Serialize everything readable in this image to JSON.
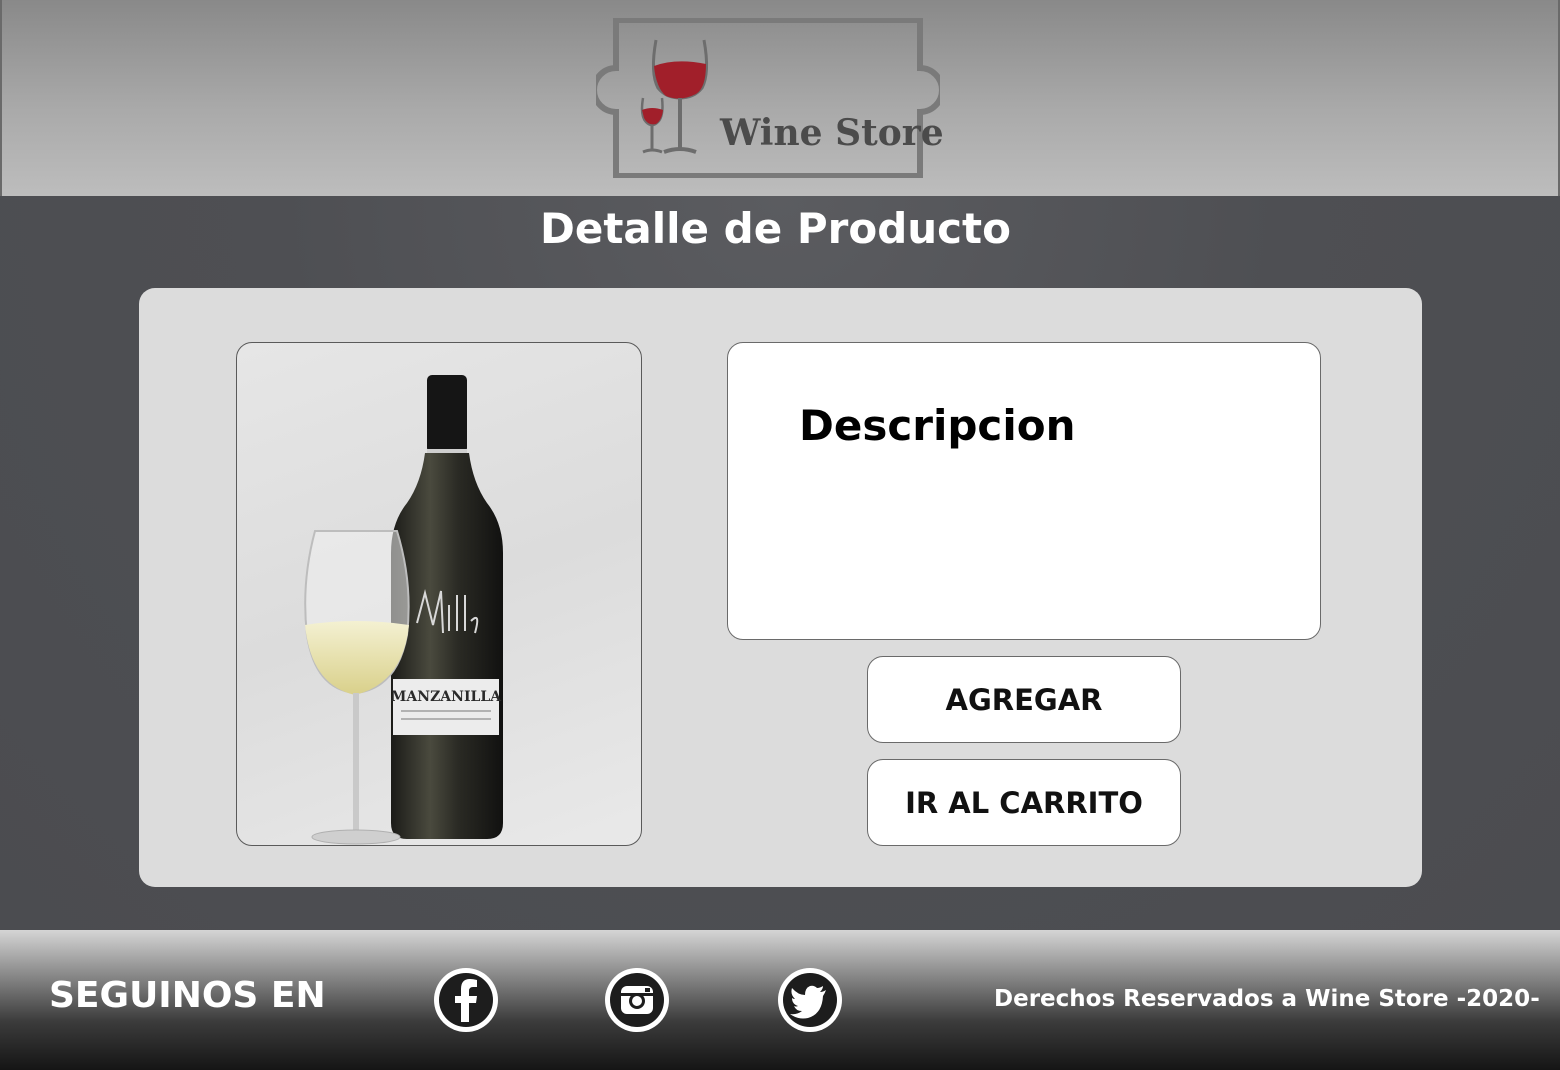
{
  "header": {
    "logo_text": "Wine Store",
    "logo_icon": "wine-glass-icon"
  },
  "main": {
    "page_title": "Detalle de Producto",
    "product": {
      "image_label": "MANZANILLA",
      "image_brand": "Milla",
      "image_icon": "wine-bottle-and-glass-image"
    },
    "description": {
      "title": "Descripcion"
    },
    "buttons": {
      "add_label": "AGREGAR",
      "cart_label": "IR AL CARRITO"
    }
  },
  "footer": {
    "follow_label": "SEGUINOS EN",
    "social": [
      {
        "name": "facebook",
        "icon": "facebook-icon"
      },
      {
        "name": "instagram",
        "icon": "instagram-icon"
      },
      {
        "name": "twitter",
        "icon": "twitter-icon"
      }
    ],
    "copyright": "Derechos Reservados a Wine Store -2020-"
  },
  "colors": {
    "background": "#4f5054",
    "panel": "#dcdcdc",
    "card": "#ffffff",
    "wine_red": "#a11f2a"
  }
}
